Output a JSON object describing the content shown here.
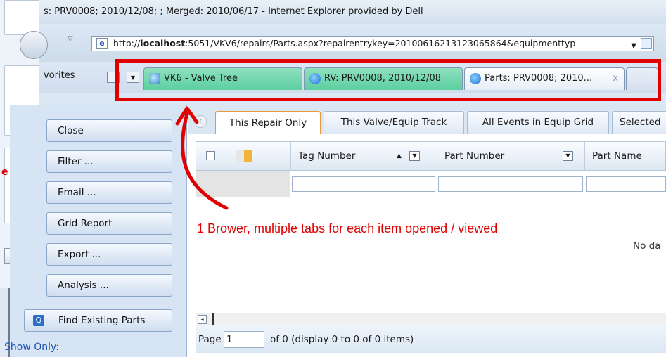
{
  "window": {
    "title": "s: PRV0008; 2010/12/08; ; Merged: 2010/06/17 - Internet Explorer provided by Dell",
    "address_prefix": "http://",
    "address_host": "localhost",
    "address_rest": ":5051/VKV6/repairs/Parts.aspx?repairentrykey=20100616213123065864&equipmenttyp",
    "favorites_label": "vorites"
  },
  "tabs": [
    {
      "label": "VK6 - Valve Tree",
      "icon": "valve-tree-icon"
    },
    {
      "label": "RV: PRV0008, 2010/12/08",
      "icon": "ie-page-icon"
    },
    {
      "label": "Parts: PRV0008; 2010...",
      "icon": "ie-page-icon",
      "close": "x"
    }
  ],
  "sidebar": {
    "buttons": [
      "Close",
      "Filter ...",
      "Email ...",
      "Grid Report",
      "Export ...",
      "Analysis ..."
    ],
    "find_existing": "Find Existing Parts",
    "show_only": "Show Only:"
  },
  "background_dialog": {
    "red_char": "e"
  },
  "grid_tabs": [
    "This Repair Only",
    "This Valve/Equip Track",
    "All Events in Equip Grid",
    "Selected"
  ],
  "grid": {
    "columns": [
      "Tag Number",
      "Part Number",
      "Part Name"
    ],
    "no_data": "No da",
    "pager": {
      "page_label": "Page",
      "page_value": "1",
      "of_text": "of 0 (display 0 to 0 of 0 items)"
    }
  },
  "annotation": {
    "text": "1 Brower, multiple tabs for each item opened / viewed",
    "color": "#e00000"
  },
  "colors": {
    "accent_tab": "#5ccf9f",
    "annotation_red": "#e00000",
    "sidebar_bg": "#d7e4f3"
  }
}
